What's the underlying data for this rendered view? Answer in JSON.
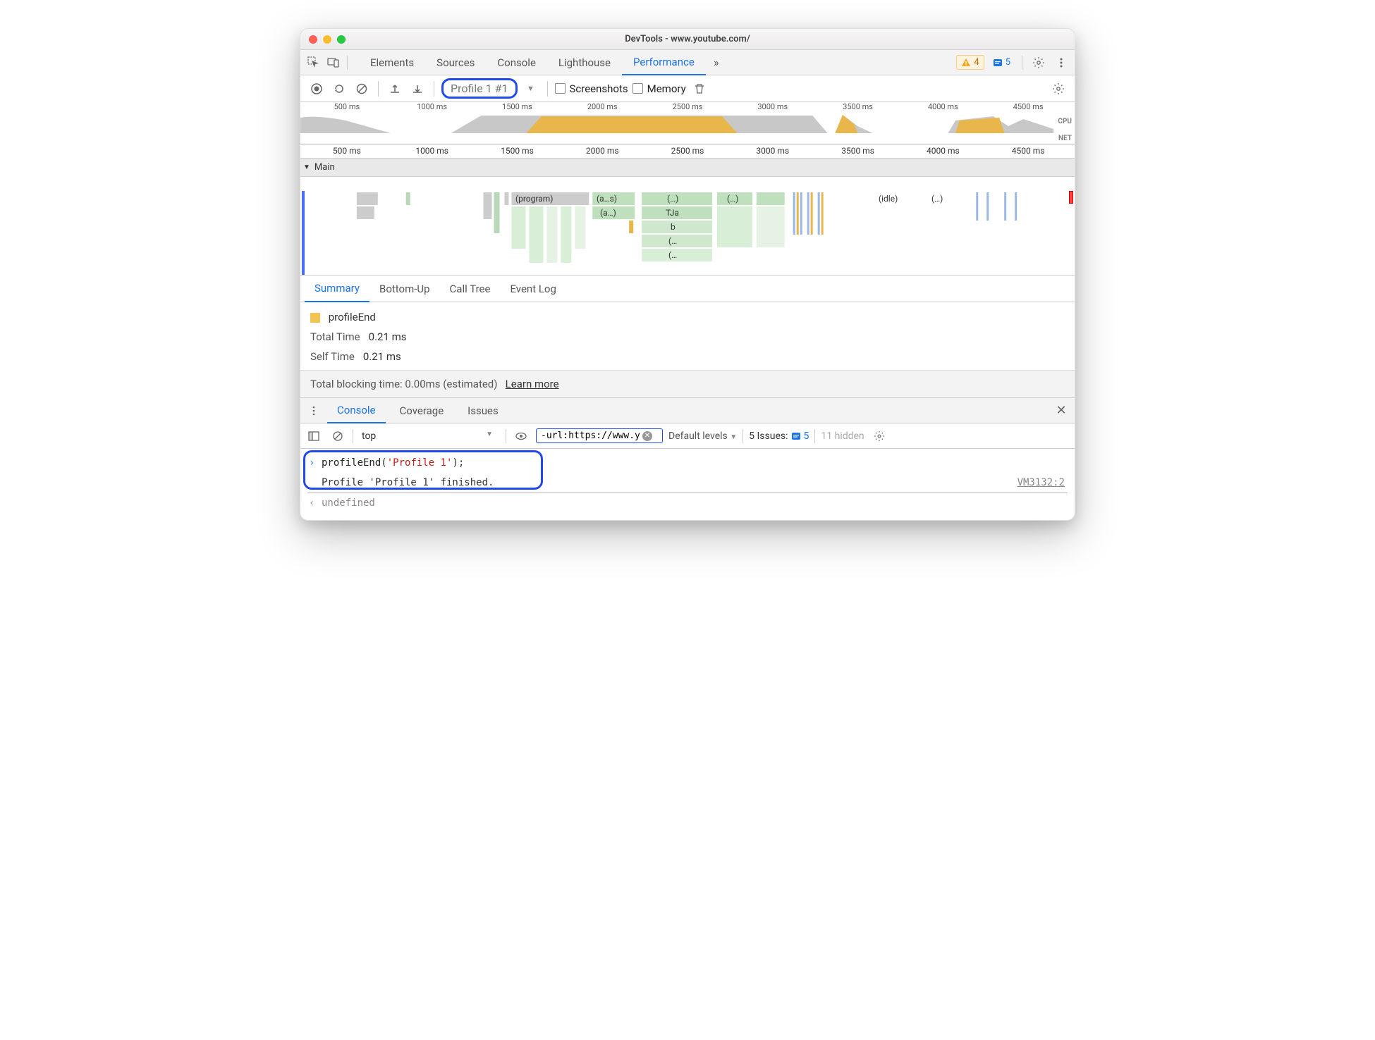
{
  "window": {
    "title": "DevTools - www.youtube.com/"
  },
  "tabs": {
    "items": [
      "Elements",
      "Sources",
      "Console",
      "Lighthouse",
      "Performance"
    ],
    "active": 4,
    "overflow": "»",
    "warnings_count": "4",
    "issues_count": "5"
  },
  "toolbar": {
    "profile_label": "Profile 1 #1",
    "screenshots_label": "Screenshots",
    "memory_label": "Memory"
  },
  "overview": {
    "ticks": [
      "500 ms",
      "1000 ms",
      "1500 ms",
      "2000 ms",
      "2500 ms",
      "3000 ms",
      "3500 ms",
      "4000 ms",
      "4500 ms"
    ],
    "cpu_label": "CPU",
    "net_label": "NET"
  },
  "flame": {
    "section": "Main",
    "labels": {
      "program": "(program)",
      "as": "(a…s)",
      "a": "(a…)",
      "dots": "(…)",
      "tja": "TJa",
      "b": "b",
      "p1": "(…",
      "p2": "(…",
      "dots2": "(…)",
      "idle": "(idle)",
      "dots3": "(…)"
    }
  },
  "detail": {
    "tabs": [
      "Summary",
      "Bottom-Up",
      "Call Tree",
      "Event Log"
    ],
    "active": 0,
    "summary": {
      "name": "profileEnd",
      "total_label": "Total Time",
      "total_value": "0.21 ms",
      "self_label": "Self Time",
      "self_value": "0.21 ms"
    },
    "tbt_text": "Total blocking time: 0.00ms (estimated)",
    "tbt_link": "Learn more"
  },
  "drawer": {
    "tabs": [
      "Console",
      "Coverage",
      "Issues"
    ],
    "active": 0
  },
  "console": {
    "context": "top",
    "filter_value": "-url:https://www.you",
    "levels_label": "Default levels",
    "issues_label": "5 Issues:",
    "issues_count": "5",
    "hidden_label": "11 hidden",
    "input_line": {
      "fn": "profileEnd",
      "arg": "'Profile 1'",
      "tail": ";"
    },
    "output_line": "Profile 'Profile 1' finished.",
    "output_src": "VM3132:2",
    "return_line": "undefined"
  }
}
